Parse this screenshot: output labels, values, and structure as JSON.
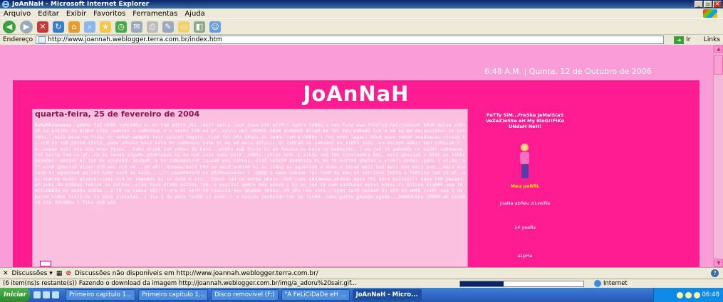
{
  "window": {
    "title": "JoAnNaH - Microsoft Internet Explorer",
    "min_btn": "_",
    "max_btn": "▫",
    "close_btn": "✕"
  },
  "menu": {
    "items": [
      "Arquivo",
      "Editar",
      "Exibir",
      "Favoritos",
      "Ferramentas",
      "Ajuda"
    ]
  },
  "toolbar": {
    "buttons": [
      "back-icon",
      "forward-icon",
      "stop-icon",
      "refresh-icon",
      "home-icon",
      "search-icon",
      "favorites-icon",
      "history-icon",
      "mail-icon",
      "print-icon",
      "edit-icon",
      "folder-icon",
      "research-icon",
      "messenger-icon"
    ]
  },
  "address": {
    "label": "Endereço",
    "url": "http://www.joannah.weblogger.terra.com.br/index.htm",
    "go_label": "Ir",
    "links_label": "Links"
  },
  "page": {
    "datetime": "6:48 A.M. | Quinta, 12 de Outubro de 2006",
    "site_title": "JoAnNaH",
    "post_date": "quarta-feira, 25 de fevereiro de 2004",
    "post_body": "kaRaMbaaaaaaa..geNte faZ mt00 teMpiNhu ki eu na0 p0Stu aki..maiS seiLa..na0 tava mt0 aFiM!! ag0ra teNhu u meu fLog www.fotolog.net/joannah b0uM deixa coNtaR un pokiNu da miNha viDa..passei u caRnavaL e o ver0n laH na pF..navis ne? aHUHUh b0uM podemuS dizeR ke f0i meu paRado laH e ke eu me decepSionei un pokiNhu...maiS beim nu finaL du veRa0 aeNpRa tein coisaS legaiS..tip0 fui pRa pRaia do soNhu cuM a deBBy i foi mt00 legaL! b0uM esse veRa0 acoNteceu coisaS ki siM eu nuM p0ss0 cOnta..pode p0sssu maiS keim mu coNheseu sabe ki eu e0 meiu diFicil di coNtaR se paRadaS da miNha vida..ou meLhoR abRii meu coRaza0 ne..aaaaa bati mta mta mtas f0tuz...kaRu dizeR na0 paRao de bate...miNha maE disse ki e0 faLata eu bate nu baNheiRu..i eu jaH t0 paRaNdu nu ka20! caRnavaL f0i baita laH na pF..r0 ke teveS aiguNs pRoblemaS ki eu na0 tava nada baiM..x0RRi..s0rei mt0..i alNda na0 t0h totalmeNte b0a..maiS gRaszaS a DEUS eu teNhu pessOas..amigaS ki ta0 me ajudaNdu animaR..e ke coNseguira0 zaLvaR meu caRnaL..elaS sabeiM kuaNtaza ki eu t0 muit00 gRatas a elaS!! dudas..gabi i aliNe..aff naiM pRecis0 dizer qt0 amu vc0 ne...aH aN!! dudaaa:maiS b0d ne seiM koNtaR ki eu tiNha ki aguentaR a duda a falaR maiz bod maiz bod maiz bod...maiS ela teve ki aguentaR eu na0 keRe saiR de kaZa....//~ pupeRanuuS ne pRiMeaaaaaaa t :@@@@ e aaaa xabado fui nueR du meu v0 aiH tave feSta a faMiiia laH na pF..mai bod(by duda) alsaialsiaai.sv0 ki seguNda eu ia duda e etc...fomuS laH na outRa pRaia..beh comu aNdamuuu.ahuhau.maiS f0i beim maiSsa!!! aaaa tbM passei uM poku da miNhas fekias in paLmas..elaS tava mt000 maiSSa laH..u pessOal geNte b0a pakaS i ki eu jaH t0 cuM saudadeS delaz mukai.tu doiuuu miq000 aaa t0 eStudaNdu nu aLpHa aiNda...e t0 na caaLa 101!!! anu ki ve!M v0 reaLiza meu gRaNde s0nhu..v0 pRa new york...ngAH teiM nossa0 de qt0 eu am00 iss0! aaa 1 de mai00 miNha faSta de 15 anoS aleteteS..i dia 2 de maio faz00 15 anoS!!! o nossSu zecReido teh um lu>00..tamu geNte gRande agoRa...AHUAHUahu iRRRR ah iss00 v0 sta fOtINhu i fika poR aiH",
    "sidebar": {
      "motto": "PaTTy SiM...FreSka JaMaiS(aS VeZeZ)eSSe eH My BloG!!FiKo UNduH NeH!",
      "avatar_caption": "Meu peRfiL",
      "name_line": "JoaNa abReu ziLveiRa",
      "spacer1": "·",
      "years": "14 yeaRs",
      "spacer2": "·",
      "alpha": "aLpHa"
    }
  },
  "discussions": {
    "label": "Discussões ▾",
    "message": "Discussões não disponíveis em http://www.joannah.weblogger.terra.com.br/"
  },
  "status": {
    "text": "(6 item(ns)s restante(s)) Fazendo o download da imagem http://joannah.weblogger.com.br/img/a_adoru%20sair.gif...",
    "progress": 0.35,
    "zone": "Internet"
  },
  "taskbar": {
    "start": "Iniciar",
    "tasks": [
      "Primeiro capitulo 1...",
      "Primeiro capitulo 1...",
      "Disco removivel (F:)",
      "\"A FeLiCiDaDe eH ...",
      "JoAnNaH - Micro..."
    ],
    "active_index": 4,
    "clock": "06:48"
  }
}
